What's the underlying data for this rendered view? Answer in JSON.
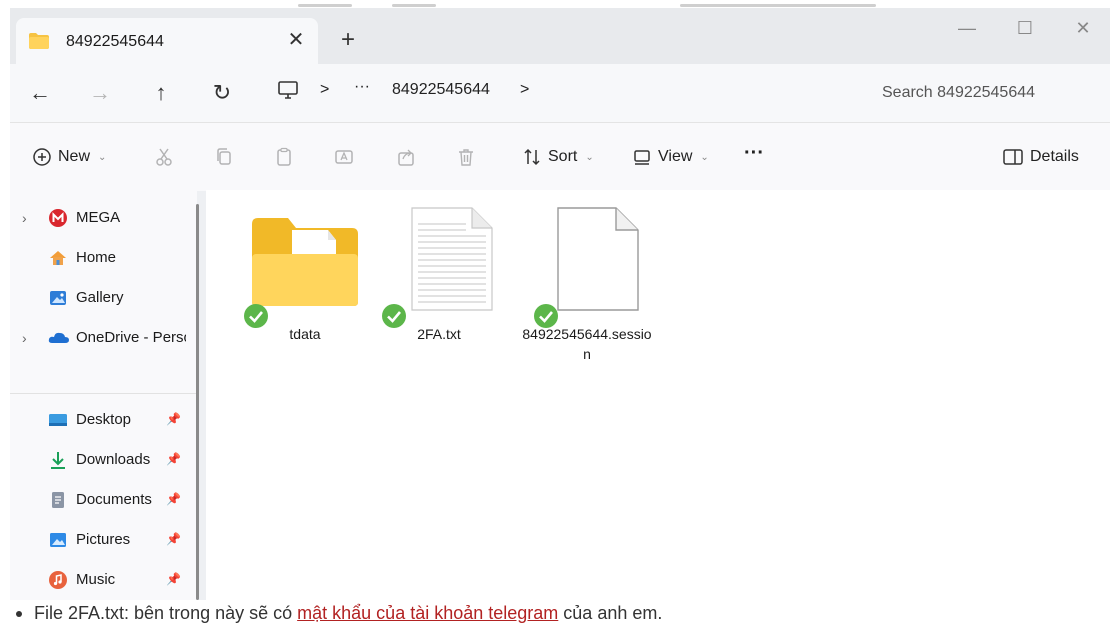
{
  "window": {
    "tab_title": "84922545644",
    "new_tab_label": "+",
    "close_tab_label": "✕",
    "controls": {
      "minimize": "—",
      "maximize": "☐",
      "close": "✕"
    }
  },
  "nav": {
    "back": "←",
    "forward": "→",
    "up": "↑",
    "refresh": "↻",
    "more": "···",
    "breadcrumb_sep": ">",
    "breadcrumb_current": "84922545644",
    "search_placeholder": "Search 84922545644"
  },
  "toolbar": {
    "new_label": "New",
    "sort_label": "Sort",
    "view_label": "View",
    "more_label": "···",
    "details_label": "Details"
  },
  "sidebar": {
    "items": [
      {
        "label": "MEGA",
        "icon": "mega-icon",
        "expandable": true
      },
      {
        "label": "Home",
        "icon": "home-icon",
        "expandable": false
      },
      {
        "label": "Gallery",
        "icon": "gallery-icon",
        "expandable": false
      },
      {
        "label": "OneDrive - Perso",
        "icon": "onedrive-icon",
        "expandable": true
      },
      {
        "label": "Desktop",
        "icon": "desktop-icon",
        "pinned": true
      },
      {
        "label": "Downloads",
        "icon": "downloads-icon",
        "pinned": true
      },
      {
        "label": "Documents",
        "icon": "documents-icon",
        "pinned": true
      },
      {
        "label": "Pictures",
        "icon": "pictures-icon",
        "pinned": true
      },
      {
        "label": "Music",
        "icon": "music-icon",
        "pinned": true
      }
    ],
    "pin_glyph": "📌",
    "chevron_glyph": "›"
  },
  "files": [
    {
      "name": "tdata",
      "kind": "folder",
      "status": "synced"
    },
    {
      "name": "2FA.txt",
      "kind": "text",
      "status": "synced"
    },
    {
      "name": "84922545644.session",
      "kind": "file",
      "status": "synced"
    }
  ],
  "caption": {
    "before": "File 2FA.txt: bên trong này sẽ có ",
    "link": "mật khẩu của tài khoản telegram",
    "after": " của anh em."
  },
  "colors": {
    "accent_folder": "#f6c343",
    "sync_green": "#5cb64a",
    "link_red": "#b22222"
  }
}
